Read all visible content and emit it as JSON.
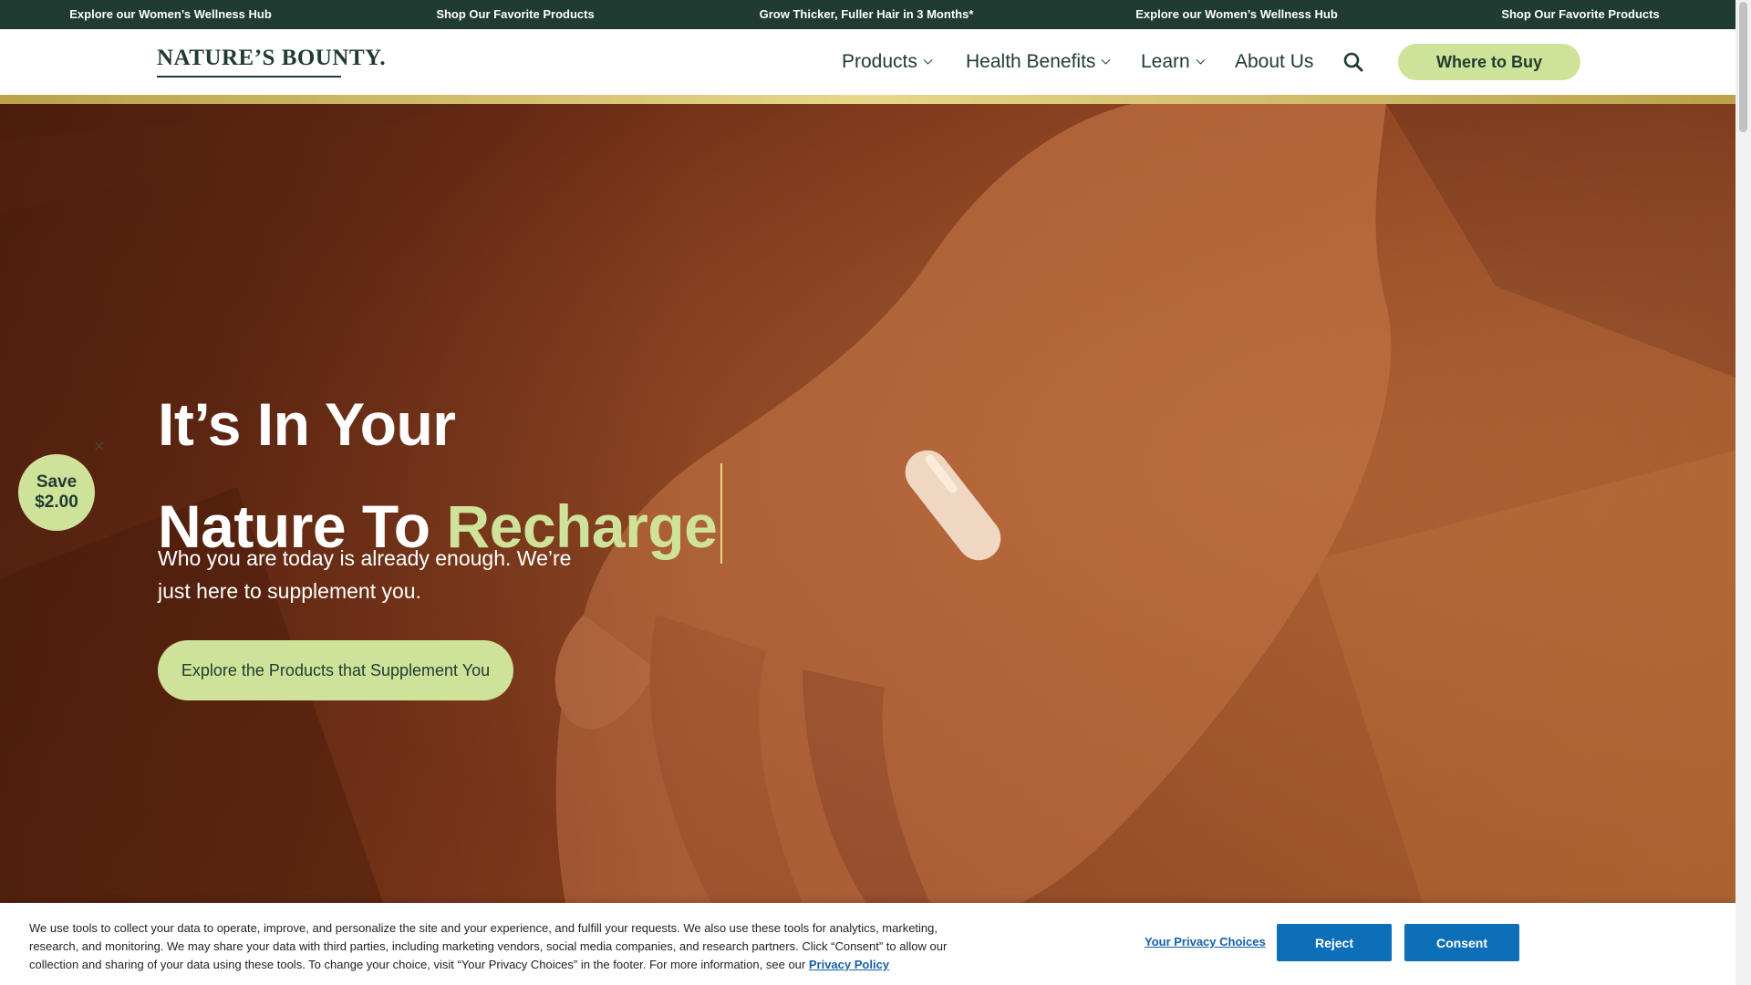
{
  "announcement": {
    "messages": [
      "Explore our Women’s Wellness Hub",
      "Shop Our Favorite Products",
      "Grow Thicker, Fuller Hair in 3 Months*",
      "Explore our Women’s Wellness Hub",
      "Shop Our Favorite Products"
    ],
    "background": "#1f3b32"
  },
  "header": {
    "logo_text": "NATURE’S BOUNTY.",
    "nav": [
      {
        "label": "Products",
        "has_dropdown": true
      },
      {
        "label": "Health Benefits",
        "has_dropdown": true
      },
      {
        "label": "Learn",
        "has_dropdown": true
      },
      {
        "label": "About Us",
        "has_dropdown": false
      }
    ],
    "search_icon": "search-icon",
    "cta_label": "Where to Buy"
  },
  "hero": {
    "title_line1": "It’s In Your",
    "title_line2_prefix": "Nature To ",
    "title_line2_accent": "Recharge",
    "subtitle": "Who you are today is already enough. We’re just here to supplement you.",
    "cta_label": "Explore the Products that Supplement You",
    "accent_color": "#cfe29a"
  },
  "save_badge": {
    "line1": "Save",
    "line2": "$2.00",
    "close_icon": "close-icon"
  },
  "cookie_banner": {
    "text": "We use tools to collect your data to operate, improve, and personalize the site and your experience, and fulfill your requests. We also use these tools for analytics, marketing, research, and monitoring. We may share your data with third parties, including marketing vendors, social media companies, and research partners. Click “Consent” to allow our collection and sharing of your data using these tools. To change your choice, visit “Your Privacy Choices” in the footer. For more information, see our",
    "privacy_policy_label": "Privacy Policy",
    "privacy_choices_label": "Your Privacy Choices",
    "reject_label": "Reject",
    "consent_label": "Consent",
    "button_color": "#0d6fb8"
  }
}
